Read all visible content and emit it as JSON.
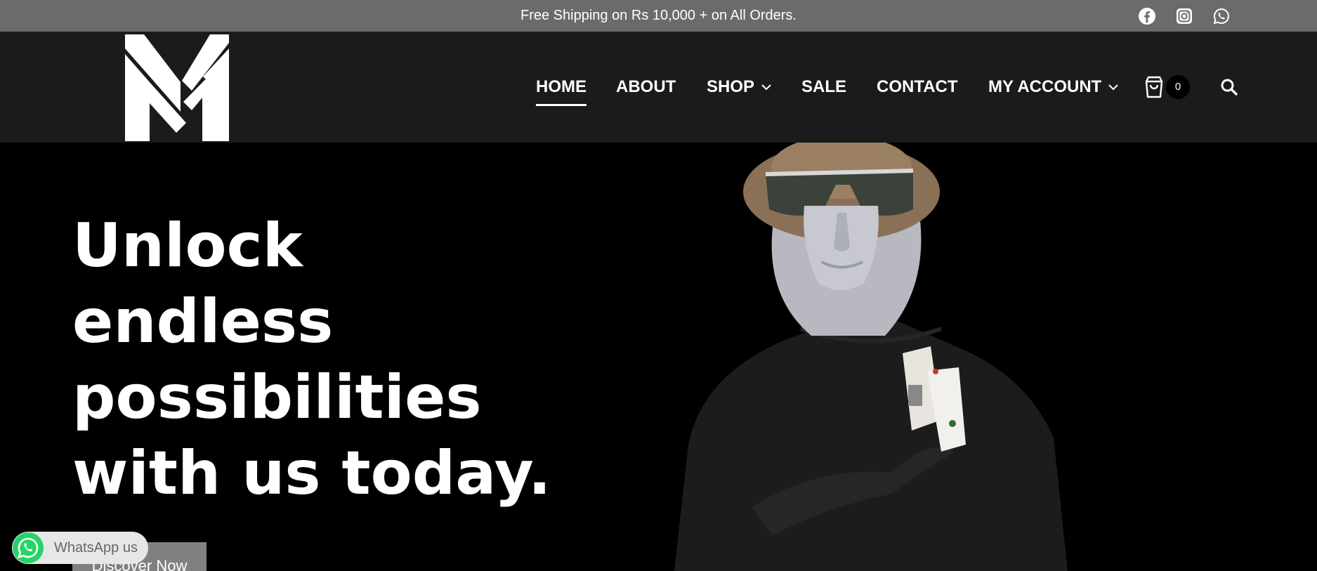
{
  "topbar": {
    "message": "Free Shipping on Rs 10,000 + on All Orders.",
    "social_icons": [
      "facebook-icon",
      "instagram-icon",
      "whatsapp-icon"
    ]
  },
  "nav": {
    "items": [
      {
        "label": "HOME",
        "active": true,
        "dropdown": false
      },
      {
        "label": "ABOUT",
        "active": false,
        "dropdown": false
      },
      {
        "label": "SHOP",
        "active": false,
        "dropdown": true
      },
      {
        "label": "SALE",
        "active": false,
        "dropdown": false
      },
      {
        "label": "CONTACT",
        "active": false,
        "dropdown": false
      },
      {
        "label": "MY ACCOUNT",
        "active": false,
        "dropdown": true
      }
    ],
    "cart_count": "0"
  },
  "hero": {
    "headline": "Unlock endless possibilities with us today.",
    "cta_label": "Discover Now"
  },
  "whatsapp_widget": {
    "label": "WhatsApp us"
  },
  "colors": {
    "topbar_bg": "#6b6b6b",
    "header_bg": "#1b1b1b",
    "hero_bg": "#000000",
    "whatsapp_green": "#25d366",
    "cta_bg": "#808080"
  }
}
